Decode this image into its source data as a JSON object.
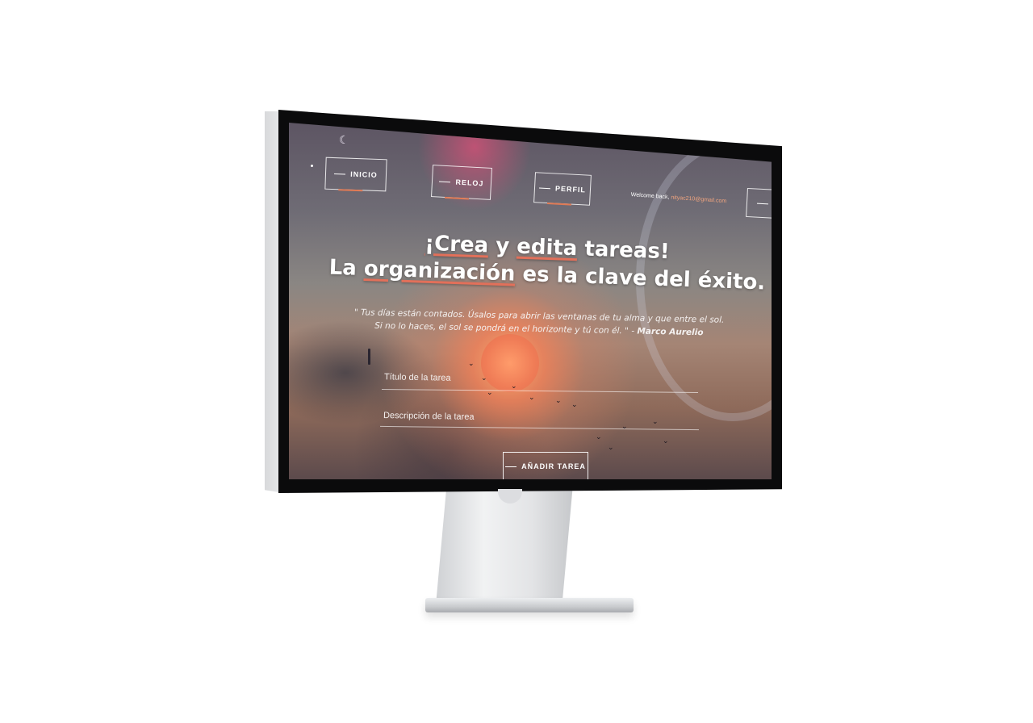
{
  "nav": {
    "items": [
      {
        "label": "INICIO"
      },
      {
        "label": "RELOJ"
      },
      {
        "label": "PERFIL"
      }
    ],
    "welcome_text": "Welcome back,",
    "welcome_email": "nityac210@gmail.com"
  },
  "hero": {
    "line1_a": "¡Crea",
    "line1_b": "y",
    "line1_c": "edita",
    "line1_d": "tareas!",
    "line2_a": "La",
    "line2_b": "organización",
    "line2_c": "es la clave del éxito."
  },
  "quote": {
    "line1": "\" Tus días están contados. Úsalos para abrir las ventanas de tu alma y que entre el sol.",
    "line2": "Si no lo haces, el sol se pondrá en el horizonte y tú con él. \" -",
    "author": "Marco Aurelio"
  },
  "form": {
    "title_placeholder": "Título de la tarea",
    "description_placeholder": "Descripción de la tarea",
    "submit_label": "AÑADIR TAREA"
  },
  "colors": {
    "accent": "#e2705a",
    "email": "#f2a57f"
  }
}
